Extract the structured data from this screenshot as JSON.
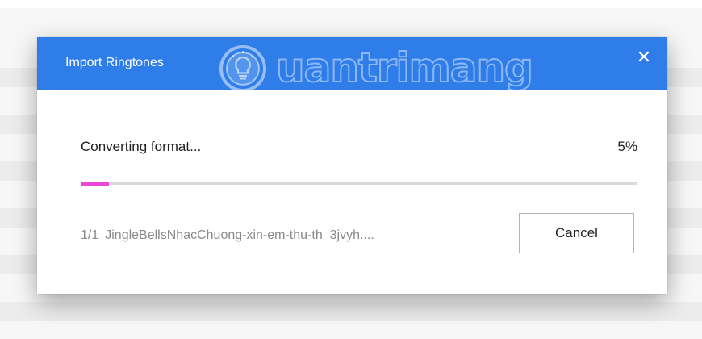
{
  "dialog": {
    "title": "Import Ringtones",
    "close_glyph": "✕",
    "close_icon": "close-icon"
  },
  "watermark": {
    "text": "uantrimang",
    "logo_icon": "lightbulb-icon"
  },
  "progress": {
    "status_text": "Converting format...",
    "percent_text": "5%",
    "value": 0.05,
    "fill_color": "#e64ad6",
    "track_color": "#d9d9d9"
  },
  "file": {
    "count": "1/1",
    "name": "JingleBellsNhacChuong-xin-em-thu-th_3jvyh...."
  },
  "buttons": {
    "cancel_label": "Cancel"
  },
  "colors": {
    "titlebar": "#2e7de8"
  }
}
